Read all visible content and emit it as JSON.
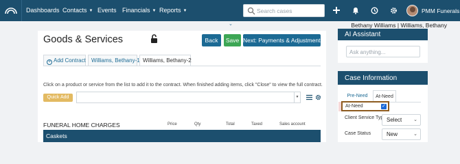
{
  "nav": {
    "items": [
      "Dashboards",
      "Contacts",
      "Events",
      "Financials",
      "Reports"
    ],
    "search_placeholder": "Search cases",
    "user_name": "PMM Funerals"
  },
  "subheader": {
    "case_name": "Bethany Williams | Williams, Bethany"
  },
  "main": {
    "title": "Goods & Services",
    "buttons": {
      "back": "Back",
      "save": "Save",
      "next": "Next: Payments & Adjustments"
    },
    "tabs": [
      "Add Contract",
      "Williams, Bethany-1",
      "Williams, Bethany-2"
    ],
    "instructions": "Click on a product or service from the list to add it to the contract. When finished adding items, click \"Close\" to view the full contract.",
    "quick_add": "Quick Add",
    "charges_title": "FUNERAL HOME CHARGES",
    "columns": [
      "Price",
      "Qty",
      "Total",
      "Taxed",
      "Sales account"
    ],
    "section": "Caskets"
  },
  "ai_assistant": {
    "title": "AI Assistant",
    "placeholder": "Ask anything..."
  },
  "case_info": {
    "title": "Case Information",
    "tabs": [
      "Pre-Need",
      "At-Need"
    ],
    "at_need_label": "At-Need",
    "at_need_checked": true,
    "client_service_type_label": "Client Service Type",
    "client_service_type_value": "Select",
    "case_status_label": "Case Status",
    "case_status_value": "New"
  },
  "colors": {
    "nav": "#1c4f6e",
    "primary_button": "#1c6a94",
    "save_button": "#3da655",
    "quick_add": "#e3ba62",
    "highlight_border": "#8c5a1f"
  }
}
